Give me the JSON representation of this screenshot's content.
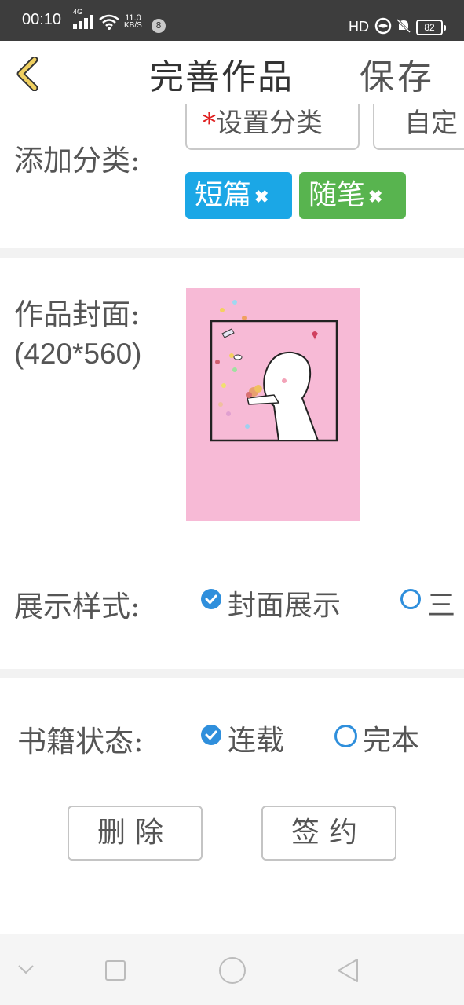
{
  "status_bar": {
    "time": "00:10",
    "network": "4G",
    "speed_value": "11.0",
    "speed_unit": "KB/S",
    "notification_count": "8",
    "hd": "HD",
    "battery": "82"
  },
  "header": {
    "title": "完善作品",
    "save_label": "保存"
  },
  "category": {
    "label": "添加分类:",
    "set_required_mark": "*",
    "set_button": "设置分类",
    "custom_button": "自定",
    "tags": [
      {
        "label": "短篇",
        "color": "#1ba7e6"
      },
      {
        "label": "随笔",
        "color": "#58b44f"
      }
    ]
  },
  "cover": {
    "label": "作品封面:",
    "size_hint": "(420*560)"
  },
  "display_style": {
    "label": "展示样式:",
    "options": [
      {
        "label": "封面展示",
        "selected": true
      },
      {
        "label": "三",
        "selected": false
      }
    ]
  },
  "book_status": {
    "label": "书籍状态:",
    "options": [
      {
        "label": "连载",
        "selected": true
      },
      {
        "label": "完本",
        "selected": false
      }
    ]
  },
  "actions": {
    "delete_label": "删除",
    "sign_label": "签约"
  },
  "colors": {
    "accent": "#2f8fdc",
    "back_arrow": "#f0d060",
    "cover_background": "#f7bad6"
  }
}
